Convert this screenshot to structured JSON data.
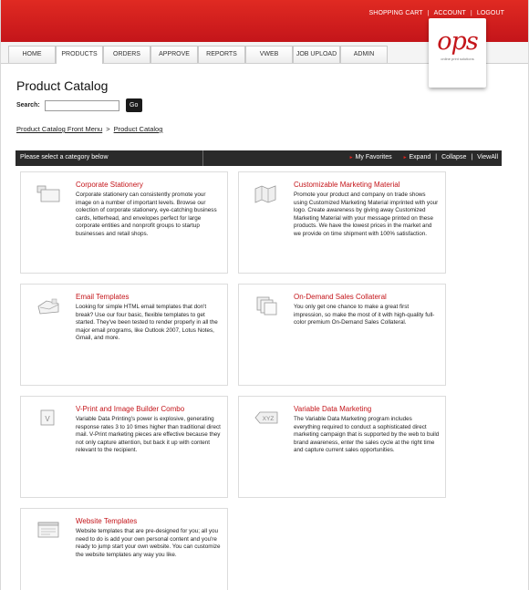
{
  "header": {
    "links": [
      "SHOPPING CART",
      "ACCOUNT",
      "LOGOUT"
    ],
    "logo_text": "ops",
    "logo_tagline": "online print solutions"
  },
  "nav": {
    "tabs": [
      "HOME",
      "PRODUCTS",
      "ORDERS",
      "APPROVE",
      "REPORTS",
      "VWEB",
      "JOB UPLOAD",
      "ADMIN"
    ],
    "active": "PRODUCTS"
  },
  "page": {
    "title": "Product Catalog",
    "search_label": "Search:",
    "search_value": "",
    "go_label": "Go",
    "breadcrumb": [
      "Product Catalog Front Menu",
      "Product Catalog"
    ]
  },
  "category_bar": {
    "prompt": "Please select a category below",
    "actions": [
      "My Favorites",
      "Expand",
      "Collapse",
      "ViewAll"
    ]
  },
  "categories": [
    {
      "title": "Corporate Stationery",
      "icon": "stationery-icon",
      "desc": "Corporate stationery can consistently promote your image on a number of important levels. Browse our colection of corporate stationery, eye-catching business cards, letterhead, and envelopes perfect for large corporate entities and nonprofit groups to startup businesses and retail shops."
    },
    {
      "title": "Customizable Marketing Material",
      "icon": "map-icon",
      "desc": "Promote your product and company on trade shows using Customized Marketing Material imprinted with your logo. Create awareness by giving away Customized Marketing Material with your message printed on these products. We have the lowest prices in the market and we provide on time shipment with 100% satisfaction."
    },
    {
      "title": "Email Templates",
      "icon": "envelope-icon",
      "desc": "Looking for simple HTML email templates that don't break? Use our four basic, flexible templates to get started. They've been tested to render properly in all the major email programs, like Outlook 2007, Lotus Notes, Gmail, and more."
    },
    {
      "title": "On-Demand Sales Collateral",
      "icon": "documents-icon",
      "desc": "You only get one chance to make a great first impression, so make the most of it with high-quality full-color premium On-Demand Sales Collateral."
    },
    {
      "title": "V-Print and Image Builder Combo",
      "icon": "v-print-icon",
      "desc": "Variable Data Printing's power is explosive, generating response rates 3 to 10 times higher than traditional direct mail. V-Print marketing pieces are effective because they not only capture attention, but back it up with content relevant to the recipient."
    },
    {
      "title": "Variable Data Marketing",
      "icon": "xyz-tag-icon",
      "desc": "The Variable Data Marketing program includes everything required to conduct a sophisticated direct marketing campaign that is supported by the web to build brand awareness, enter the sales cycle at the right time and capture current sales opportunities."
    },
    {
      "title": "Website Templates",
      "icon": "browser-window-icon",
      "desc": "Website templates that are pre-designed for you; all you need to do is add your own personal content and you're ready to jump start your own website. You can customize the website templates any way you like."
    }
  ]
}
